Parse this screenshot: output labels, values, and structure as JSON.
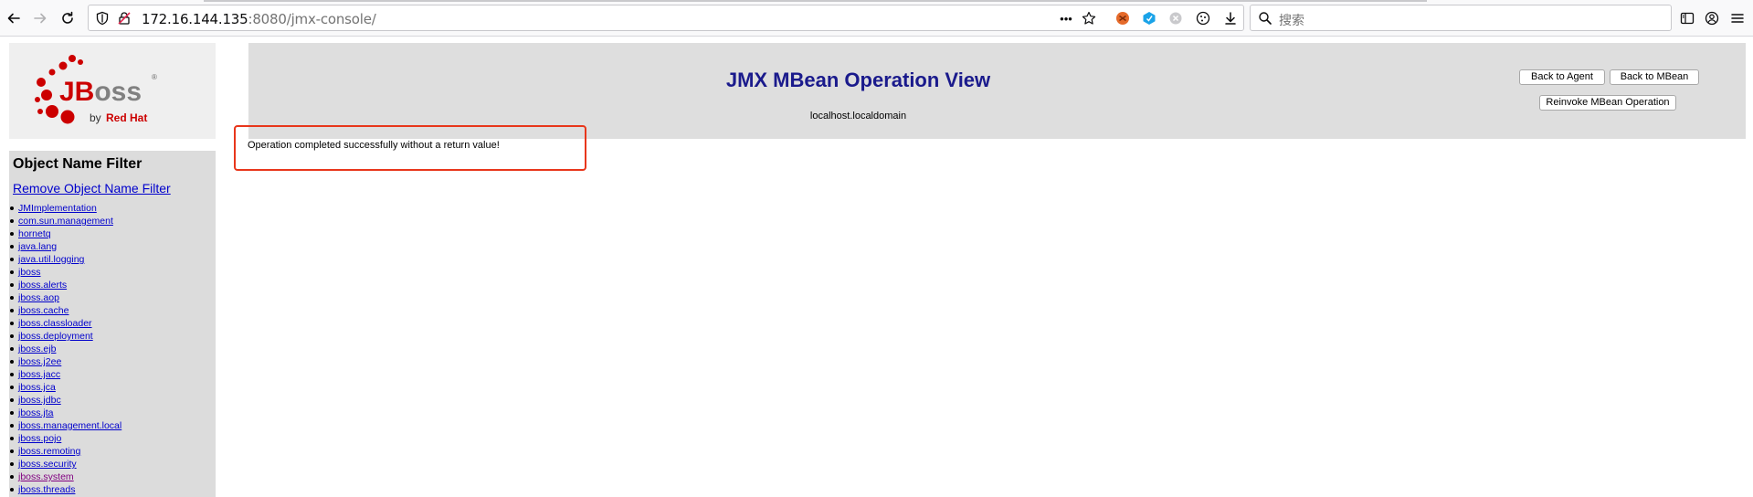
{
  "browser": {
    "url_host": "172.16.144.135",
    "url_rest": ":8080/jmx-console/",
    "search_placeholder": "搜索",
    "page_actions_label": "•••"
  },
  "sidebar": {
    "logo": {
      "brand": "JBoss",
      "tagline_prefix": "by",
      "tagline_company": "Red Hat",
      "registered_mark": "®"
    },
    "filter_title": "Object Name Filter",
    "remove_filter_label": "Remove Object Name Filter",
    "domains": [
      "JMImplementation",
      "com.sun.management",
      "hornetq",
      "java.lang",
      "java.util.logging",
      "jboss",
      "jboss.alerts",
      "jboss.aop",
      "jboss.cache",
      "jboss.classloader",
      "jboss.deployment",
      "jboss.ejb",
      "jboss.j2ee",
      "jboss.jacc",
      "jboss.jca",
      "jboss.jdbc",
      "jboss.jta",
      "jboss.management.local",
      "jboss.pojo",
      "jboss.remoting",
      "jboss.security",
      "jboss.system",
      "jboss.threads"
    ],
    "visited_domain": "jboss.system"
  },
  "header": {
    "title": "JMX MBean Operation View",
    "subtitle": "localhost.localdomain",
    "back_to_agent_label": "Back to Agent",
    "back_to_mbean_label": "Back to MBean",
    "reinvoke_label": "Reinvoke MBean Operation"
  },
  "result": {
    "message": "Operation completed successfully without a return value!"
  },
  "colors": {
    "title": "#1a1a8c",
    "link": "#0000cc",
    "visited_link": "#800080",
    "highlight": "#e8361b",
    "jboss_red": "#cc0000"
  }
}
